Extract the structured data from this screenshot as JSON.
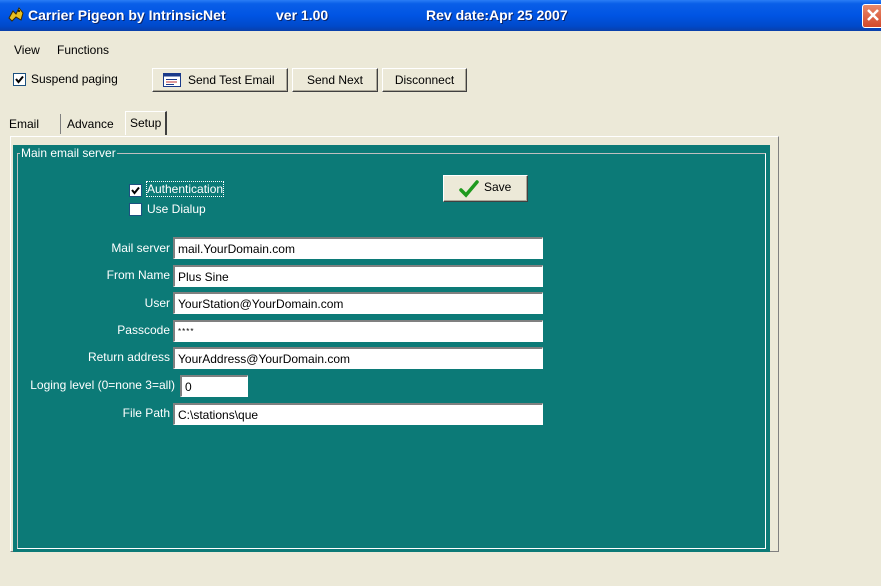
{
  "window": {
    "app_name": "Carrier Pigeon by IntrinsicNet",
    "version": "ver 1.00",
    "rev_date": "Rev date:Apr 25 2007"
  },
  "menu": [
    "View",
    "Functions"
  ],
  "toolbar": {
    "suspend_label": "Suspend paging",
    "suspend_checked": true,
    "send_test_label": "Send Test Email",
    "send_next_label": "Send Next",
    "disconnect_label": "Disconnect"
  },
  "tabs": [
    {
      "label": "Email",
      "active": false
    },
    {
      "label": "Advance",
      "active": false
    },
    {
      "label": "Setup",
      "active": true
    }
  ],
  "group": {
    "title": "Main email server",
    "authentication_label": "Authentication",
    "authentication_checked": true,
    "dialup_label": "Use Dialup",
    "dialup_checked": false,
    "save_label": "Save"
  },
  "fields": {
    "mail_server": {
      "label": "Mail server",
      "value": "mail.YourDomain.com"
    },
    "from_name": {
      "label": "From Name",
      "value": "Plus Sine"
    },
    "user": {
      "label": "User",
      "value": "YourStation@YourDomain.com"
    },
    "passcode": {
      "label": "Passcode",
      "value": "****"
    },
    "return_address": {
      "label": "Return address",
      "value": "YourAddress@YourDomain.com"
    },
    "logging_level": {
      "label": "Loging level (0=none 3=all)",
      "value": "0"
    },
    "file_path": {
      "label": "File Path",
      "value": "C:\\stations\\que"
    }
  },
  "colors": {
    "titlebar": "#0054e3",
    "panel": "#0c7a77",
    "window_bg": "#ece9d8",
    "save_check": "#1e9a1e"
  },
  "icons": [
    "pigeon-app-icon",
    "close-icon",
    "email-list-icon",
    "checkmark-icon"
  ]
}
